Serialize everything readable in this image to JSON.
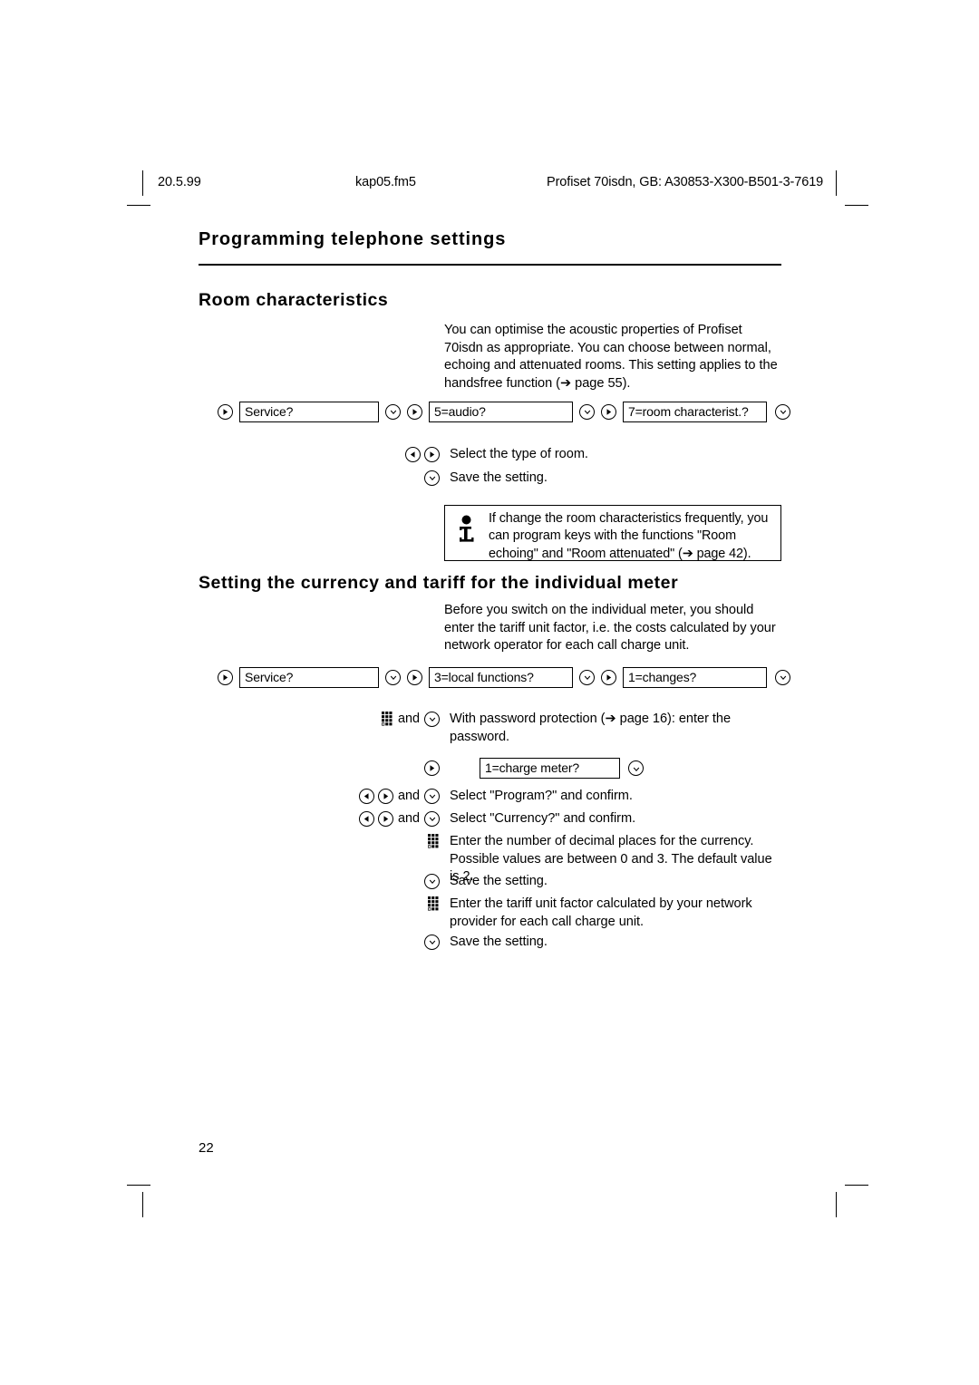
{
  "header": {
    "date": "20.5.99",
    "filename": "kap05.fm5",
    "document_id": "Profiset 70isdn, GB: A30853-X300-B501-3-7619"
  },
  "chapter_title": "Programming telephone settings",
  "sections": [
    {
      "heading": "Room characteristics",
      "intro": "You can optimise the acoustic properties of Profiset 70isdn as appropriate. You can choose between normal, echoing and attenuated rooms. This setting applies to the handsfree function (➔ page 55).",
      "sequence": [
        {
          "box": "Service?"
        },
        {
          "box": "5=audio?"
        },
        {
          "box": "7=room characterist.?"
        }
      ],
      "steps": [
        {
          "icons": "left-right",
          "text": "Select the type of room."
        },
        {
          "icons": "confirm",
          "text": "Save the setting."
        }
      ],
      "note": "If change the room characteristics frequently, you can program keys with the functions \"Room echoing\" and \"Room attenuated\" (➔ page 42)."
    },
    {
      "heading": "Setting the currency and tariff for the individual meter",
      "intro": "Before you switch on the individual meter, you should enter the tariff unit factor, i.e. the costs calculated by your network operator for each call charge unit.",
      "sequence": [
        {
          "box": "Service?"
        },
        {
          "box": "3=local functions?"
        },
        {
          "box": "1=changes?"
        }
      ],
      "steps": [
        {
          "icons": "keypad-and-confirm",
          "text": "With password protection (➔ page 16): enter the password."
        },
        {
          "icons": "right-only",
          "box": "1=charge meter?"
        },
        {
          "icons": "left-right-and-confirm",
          "text": "Select \"Program?\" and confirm."
        },
        {
          "icons": "left-right-and-confirm",
          "text": "Select \"Currency?\" and confirm."
        },
        {
          "icons": "keypad",
          "text": "Enter the number of decimal places for the currency. Possible values are between 0 and 3. The default value is 2."
        },
        {
          "icons": "confirm",
          "text": "Save the setting."
        },
        {
          "icons": "keypad",
          "text": "Enter the tariff unit factor calculated by your network provider for each call charge unit."
        },
        {
          "icons": "confirm",
          "text": "Save the setting."
        }
      ]
    }
  ],
  "labels": {
    "and": "and"
  },
  "page_number": "22"
}
